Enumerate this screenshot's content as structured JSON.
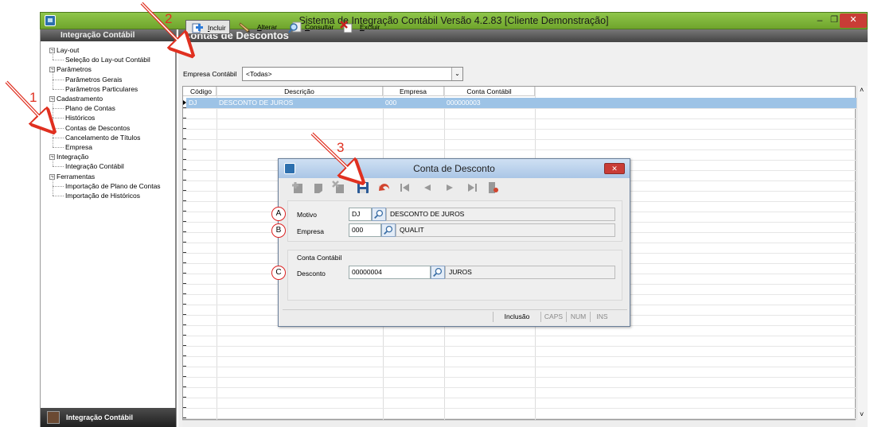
{
  "window": {
    "title": "Sistema de Integração Contábil Versão 4.2.83 [Cliente Demonstração]",
    "min_glyph": "–",
    "max_glyph": "❐",
    "close_glyph": "✕"
  },
  "sidebar": {
    "header": "Integração Contábil",
    "tree": [
      {
        "label": "Lay-out",
        "pm": "−"
      },
      {
        "label": "Seleção do Lay-out Contábil"
      },
      {
        "label": "Parâmetros",
        "pm": "−"
      },
      {
        "label": "Parâmetros Gerais"
      },
      {
        "label": "Parâmetros Particulares"
      },
      {
        "label": "Cadastramento",
        "pm": "−"
      },
      {
        "label": "Plano de Contas"
      },
      {
        "label": "Históricos"
      },
      {
        "label": "Contas de Descontos"
      },
      {
        "label": "Cancelamento de Títulos"
      },
      {
        "label": "Empresa"
      },
      {
        "label": "Integração",
        "pm": "−"
      },
      {
        "label": "Integração Contábil"
      },
      {
        "label": "Ferramentas",
        "pm": "−"
      },
      {
        "label": "Importação de Plano de Contas"
      },
      {
        "label": "Importação de Históricos"
      }
    ],
    "footer": "Integração Contábil"
  },
  "main": {
    "title": "Contas de Descontos",
    "toolbar": [
      {
        "ul": "I",
        "rest": "ncluir",
        "icon": "add-icon"
      },
      {
        "ul": "A",
        "rest": "lterar",
        "icon": "edit-icon"
      },
      {
        "ul": "C",
        "rest": "onsultar",
        "icon": "search-icon"
      },
      {
        "ul": "E",
        "rest": "xcluir",
        "icon": "delete-icon"
      }
    ],
    "empresa_label": "Empresa Contábil",
    "empresa_value": "<Todas>",
    "grid": {
      "columns": [
        "Código",
        "Descrição",
        "Empresa",
        "Conta Contábil"
      ],
      "row": [
        "DJ",
        "DESCONTO DE JUROS",
        "000",
        "000000003"
      ]
    }
  },
  "dialog": {
    "title": "Conta de Desconto",
    "close_glyph": "✕",
    "motivo": {
      "label": "Motivo",
      "value": "DJ",
      "desc": "DESCONTO DE JUROS"
    },
    "empresa": {
      "label": "Empresa",
      "value": "000",
      "desc": "QUALIT"
    },
    "conta_group_label": "Conta Contábil",
    "desconto": {
      "label": "Desconto",
      "value": "00000004",
      "desc": "JUROS"
    },
    "status": [
      "Inclusão",
      "CAPS",
      "NUM",
      "INS"
    ]
  },
  "annotations": {
    "n1": "1",
    "n2": "2",
    "n3": "3",
    "a": "A",
    "b": "B",
    "c": "C"
  },
  "colors": {
    "title_green": "#7cb342",
    "selection_blue": "#9dc3e6",
    "annotation_red": "#e03020"
  }
}
